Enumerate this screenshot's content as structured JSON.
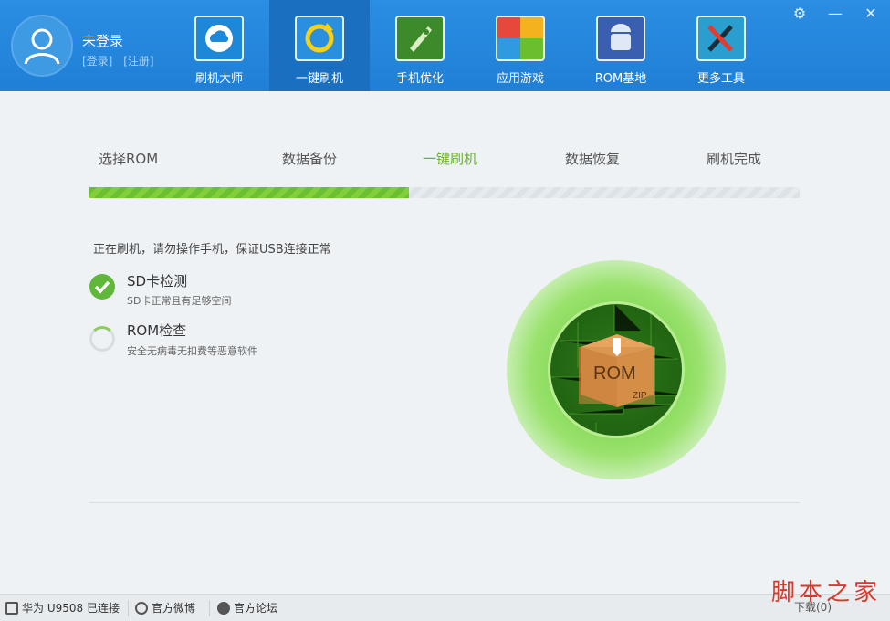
{
  "user": {
    "name": "未登录",
    "login": "[登录]",
    "register": "[注册]"
  },
  "nav": [
    {
      "label": "刷机大师",
      "icon": "cloud-icon",
      "color": "#1f88d9"
    },
    {
      "label": "一键刷机",
      "icon": "refresh-icon",
      "color": "#2a8fde",
      "active": true
    },
    {
      "label": "手机优化",
      "icon": "rocket-icon",
      "color": "#3d8a2a"
    },
    {
      "label": "应用游戏",
      "icon": "apps-grid-icon",
      "color": "#e8473c"
    },
    {
      "label": "ROM基地",
      "icon": "android-icon",
      "color": "#3a5fb0"
    },
    {
      "label": "更多工具",
      "icon": "tools-icon",
      "color": "#2a9fcf"
    }
  ],
  "window": {
    "settings": "⚙",
    "minimize": "—",
    "close": "✕"
  },
  "steps": [
    "选择ROM",
    "数据备份",
    "一键刷机",
    "数据恢复",
    "刷机完成"
  ],
  "progress_percent": 45,
  "status_text": "正在刷机，请勿操作手机，保证USB连接正常",
  "checks": [
    {
      "title": "SD卡检测",
      "sub": "SD卡正常且有足够空间",
      "state": "done"
    },
    {
      "title": "ROM检查",
      "sub": "安全无病毒无扣费等恶意软件",
      "state": "pending"
    }
  ],
  "rom_box": {
    "label": "ROM",
    "tag": "ZIP"
  },
  "statusbar": {
    "device": "华为 U9508 已连接",
    "weibo": "官方微博",
    "forum": "官方论坛",
    "download": "下载(0)"
  },
  "watermark": "脚本之家",
  "colors": {
    "header": "#2288dd",
    "accent_green": "#6ab12d"
  }
}
